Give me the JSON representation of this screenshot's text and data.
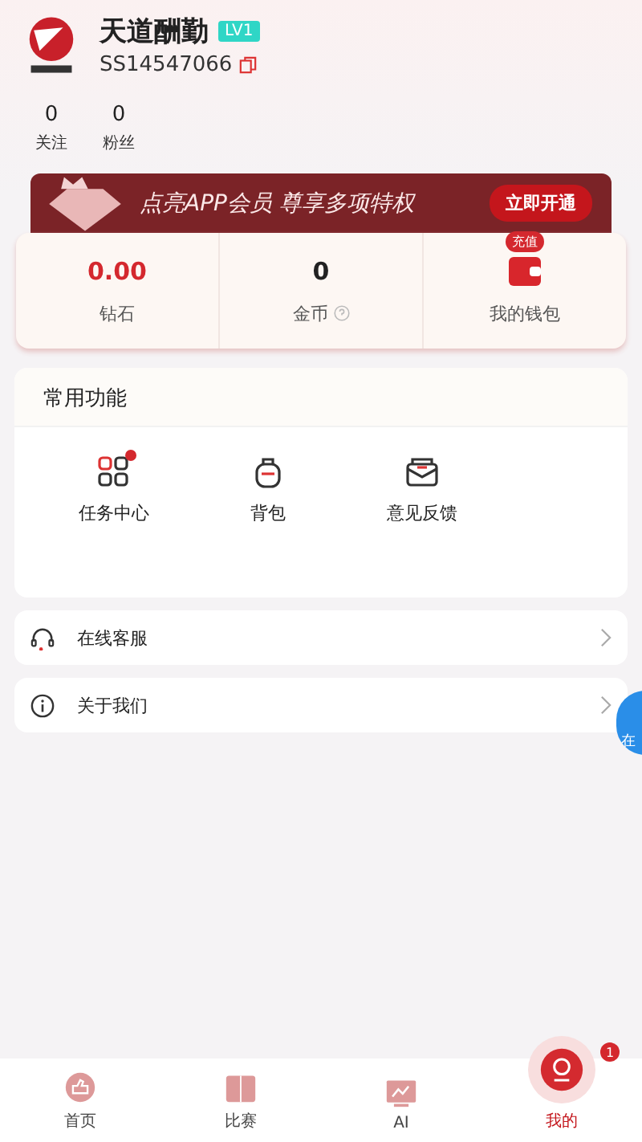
{
  "profile": {
    "name": "天道酬勤",
    "level": "LV1",
    "user_id": "SS14547066"
  },
  "stats": [
    {
      "value": "0",
      "label": "关注"
    },
    {
      "value": "0",
      "label": "粉丝"
    }
  ],
  "vip_banner": {
    "text": "点亮APP会员 尊享多项特权",
    "button": "立即开通"
  },
  "wallet": [
    {
      "kind": "amount",
      "value": "0.00",
      "label": "钻石"
    },
    {
      "kind": "coin",
      "value": "0",
      "label": "金币"
    },
    {
      "kind": "wallet",
      "badge": "充值",
      "label": "我的钱包"
    }
  ],
  "common_functions": {
    "title": "常用功能",
    "items": [
      {
        "kind": "tasks",
        "label": "任务中心",
        "badge_dot": true
      },
      {
        "kind": "backpack",
        "label": "背包",
        "badge_dot": false
      },
      {
        "kind": "feedback",
        "label": "意见反馈",
        "badge_dot": false
      }
    ]
  },
  "menu": [
    {
      "kind": "headset",
      "label": "在线客服"
    },
    {
      "kind": "info",
      "label": "关于我们"
    }
  ],
  "floating_widget": {
    "text": "在"
  },
  "tab_bar": [
    {
      "kind": "home",
      "label": "首页",
      "selected": false
    },
    {
      "kind": "match",
      "label": "比赛",
      "selected": false
    },
    {
      "kind": "ai",
      "label": "AI",
      "selected": false
    },
    {
      "kind": "me",
      "label": "我的",
      "selected": true,
      "badge": "1"
    }
  ]
}
